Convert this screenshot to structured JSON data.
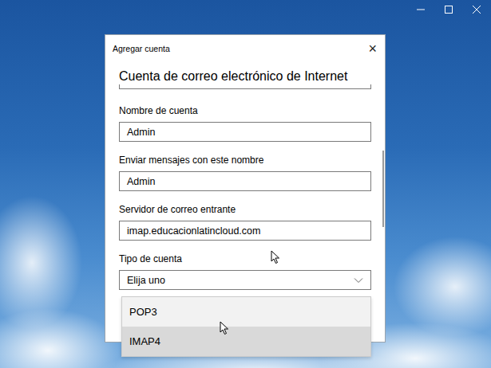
{
  "dialog": {
    "title": "Agregar cuenta",
    "close": "×",
    "heading": "Cuenta de correo electrónico de Internet"
  },
  "fields": [
    {
      "label": "Nombre de cuenta",
      "value": "Admin",
      "kind": "text"
    },
    {
      "label": "Enviar mensajes con este nombre",
      "value": "Admin",
      "kind": "text"
    },
    {
      "label": "Servidor de correo entrante",
      "value": "imap.educacionlatincloud.com",
      "kind": "text"
    },
    {
      "label": "Tipo de cuenta",
      "value": "Elija uno",
      "kind": "select",
      "expanded": true
    }
  ],
  "dropdown": {
    "options": [
      {
        "label": "POP3",
        "highlighted": false
      },
      {
        "label": "IMAP4",
        "highlighted": true
      }
    ]
  }
}
